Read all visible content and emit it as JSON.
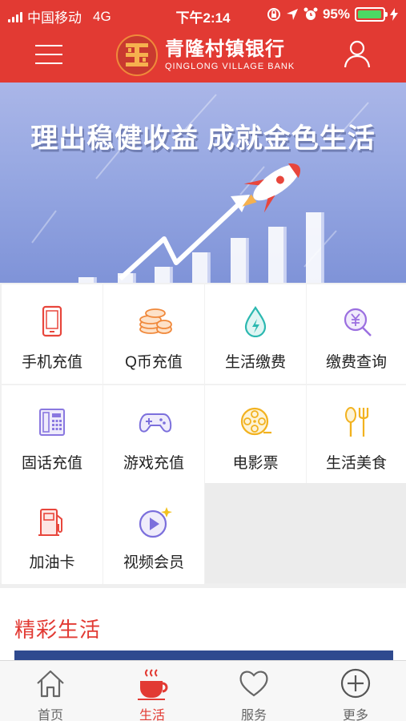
{
  "status_bar": {
    "carrier": "中国移动",
    "network": "4G",
    "time": "下午2:14",
    "battery": "95%",
    "battery_level": 0.95
  },
  "header": {
    "bank_name": "青隆村镇银行",
    "bank_name_en": "QINGLONG VILLAGE BANK",
    "menu_icon": "hamburger-menu-icon",
    "user_icon": "user-icon"
  },
  "banner": {
    "slogan": "理出稳健收益 成就金色生活"
  },
  "services": [
    {
      "label": "手机充值",
      "icon": "mobile-phone-icon",
      "color": "#e8463c"
    },
    {
      "label": "Q币充值",
      "icon": "coins-icon",
      "color": "#f0883a"
    },
    {
      "label": "生活缴费",
      "icon": "water-drop-icon",
      "color": "#2bb8b0"
    },
    {
      "label": "缴费查询",
      "icon": "yuan-search-icon",
      "color": "#9b6fe0"
    },
    {
      "label": "固话充值",
      "icon": "landline-phone-icon",
      "color": "#8a78e0"
    },
    {
      "label": "游戏充值",
      "icon": "gamepad-icon",
      "color": "#7b6fdc"
    },
    {
      "label": "电影票",
      "icon": "film-reel-icon",
      "color": "#f2b21f"
    },
    {
      "label": "生活美食",
      "icon": "spoon-fork-icon",
      "color": "#f2b21f"
    },
    {
      "label": "加油卡",
      "icon": "fuel-pump-icon",
      "color": "#e8463c"
    },
    {
      "label": "视频会员",
      "icon": "video-play-icon",
      "color": "#7b6fdc"
    }
  ],
  "section": {
    "title": "精彩生活"
  },
  "tabbar": [
    {
      "label": "首页",
      "icon": "home-icon",
      "active": false
    },
    {
      "label": "生活",
      "icon": "coffee-cup-icon",
      "active": true
    },
    {
      "label": "服务",
      "icon": "heart-icon",
      "active": false
    },
    {
      "label": "更多",
      "icon": "plus-circle-icon",
      "active": false
    }
  ],
  "colors": {
    "brand_red": "#e23a33",
    "active_tab": "#e23a33",
    "inactive_tab": "#666666"
  }
}
